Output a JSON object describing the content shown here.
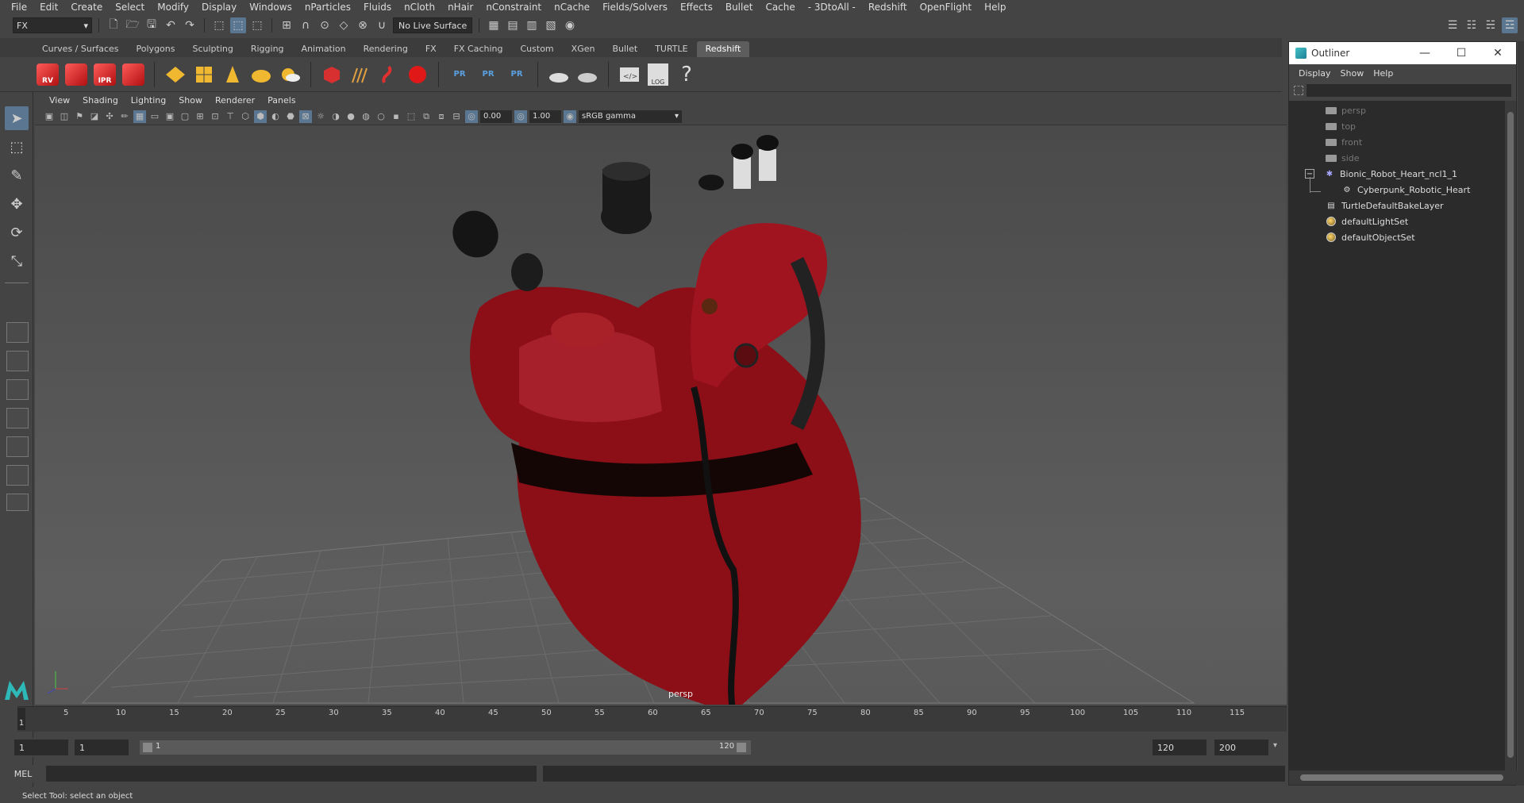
{
  "menubar": {
    "items": [
      "File",
      "Edit",
      "Create",
      "Select",
      "Modify",
      "Display",
      "Windows",
      "nParticles",
      "Fluids",
      "nCloth",
      "nHair",
      "nConstraint",
      "nCache",
      "Fields/Solvers",
      "Effects",
      "Bullet",
      "Cache",
      "- 3DtoAll -",
      "Redshift",
      "OpenFlight",
      "Help"
    ]
  },
  "statusline": {
    "menu_set": "FX",
    "live_surface": "No Live Surface"
  },
  "shelf": {
    "tabs": [
      "Curves / Surfaces",
      "Polygons",
      "Sculpting",
      "Rigging",
      "Animation",
      "Rendering",
      "FX",
      "FX Caching",
      "Custom",
      "XGen",
      "Bullet",
      "TURTLE",
      "Redshift"
    ],
    "active_tab": "Redshift",
    "rs_labels": [
      "RV",
      "",
      "IPR",
      ""
    ],
    "pr_labels": [
      "PR",
      "PR",
      "PR"
    ],
    "log_label": "LOG",
    "help_glyph": "?"
  },
  "panel": {
    "menus": [
      "View",
      "Shading",
      "Lighting",
      "Show",
      "Renderer",
      "Panels"
    ],
    "exposure": "0.00",
    "gamma": "1.00",
    "colorspace": "sRGB gamma",
    "camera_label": "persp"
  },
  "timeline": {
    "ticks": [
      "5",
      "10",
      "15",
      "20",
      "25",
      "30",
      "35",
      "40",
      "45",
      "50",
      "55",
      "60",
      "65",
      "70",
      "75",
      "80",
      "85",
      "90",
      "95",
      "100",
      "105",
      "110",
      "115"
    ],
    "current_frame": "1",
    "range_start": "1",
    "playback_start": "1",
    "slider_start": "1",
    "slider_end": "120",
    "playback_end": "120",
    "range_end": "200"
  },
  "cmdline": {
    "label": "MEL"
  },
  "helpline": {
    "text": "Select Tool: select an object"
  },
  "outliner": {
    "title": "Outliner",
    "menus": [
      "Display",
      "Show",
      "Help"
    ],
    "rows": [
      {
        "label": "persp",
        "type": "camera",
        "dim": true
      },
      {
        "label": "top",
        "type": "camera",
        "dim": true
      },
      {
        "label": "front",
        "type": "camera",
        "dim": true
      },
      {
        "label": "side",
        "type": "camera",
        "dim": true
      },
      {
        "label": "Bionic_Robot_Heart_ncl1_1",
        "type": "group"
      },
      {
        "label": "Cyberpunk_Robotic_Heart",
        "type": "mesh"
      },
      {
        "label": "TurtleDefaultBakeLayer",
        "type": "bake"
      },
      {
        "label": "defaultLightSet",
        "type": "set"
      },
      {
        "label": "defaultObjectSet",
        "type": "set"
      }
    ]
  },
  "colors": {
    "active_blue": "#5a7690",
    "heart_red": "#8c0f18",
    "ui_bg": "#444444"
  }
}
